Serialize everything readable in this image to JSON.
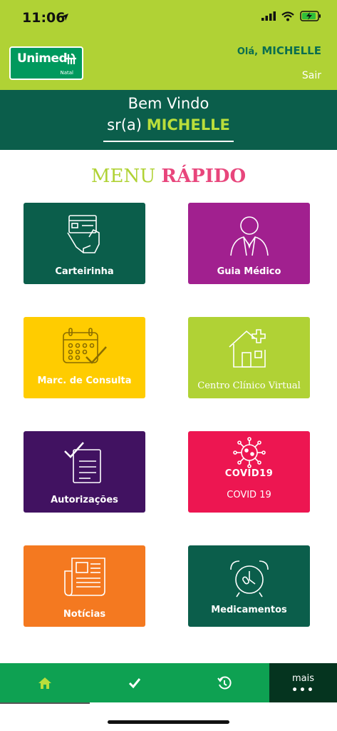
{
  "status_bar": {
    "time": "11:06",
    "icons": [
      "location-arrow-icon",
      "signal-icon",
      "wifi-icon",
      "battery-charging-icon"
    ]
  },
  "header": {
    "logo_text": "Unimed",
    "logo_subtext": "Natal",
    "greeting_prefix": "Olá,",
    "greeting_name": "MICHELLE",
    "logout_label": "Sair"
  },
  "welcome": {
    "line1": "Bem Vindo",
    "line2_prefix": "sr(a)",
    "line2_name": "MICHELLE"
  },
  "menu": {
    "title_part1": "MENU",
    "title_part2": "RÁPIDO",
    "tiles": [
      {
        "label": "Carteirinha",
        "icon": "card-in-hand-icon",
        "color": "#0b5e4b"
      },
      {
        "label": "Guia Médico",
        "icon": "doctor-icon",
        "color": "#a1208f"
      },
      {
        "label": "Marc. de Consulta",
        "icon": "calendar-check-icon",
        "color": "#ffcc00"
      },
      {
        "label": "Centro Clínico Virtual",
        "icon": "clinic-house-icon",
        "color": "#b0d235"
      },
      {
        "label": "Autorizações",
        "icon": "checklist-icon",
        "color": "#411261"
      },
      {
        "label": "COVID 19",
        "icon": "virus-icon",
        "icon_text": "COVID19",
        "color": "#ed1651"
      },
      {
        "label": "Notícias",
        "icon": "newspaper-icon",
        "color": "#f47920"
      },
      {
        "label": "Medicamentos",
        "icon": "alarm-clock-icon",
        "color": "#0b5e4b"
      }
    ]
  },
  "bottom_nav": {
    "items": [
      {
        "icon": "home-icon"
      },
      {
        "icon": "check-icon"
      },
      {
        "icon": "history-icon"
      }
    ],
    "more_label": "mais",
    "more_dots": "•••"
  },
  "colors": {
    "lime": "#b0d235",
    "dark_green": "#0b5e4b",
    "nav_green": "#0ea152",
    "pink": "#e8467c"
  }
}
